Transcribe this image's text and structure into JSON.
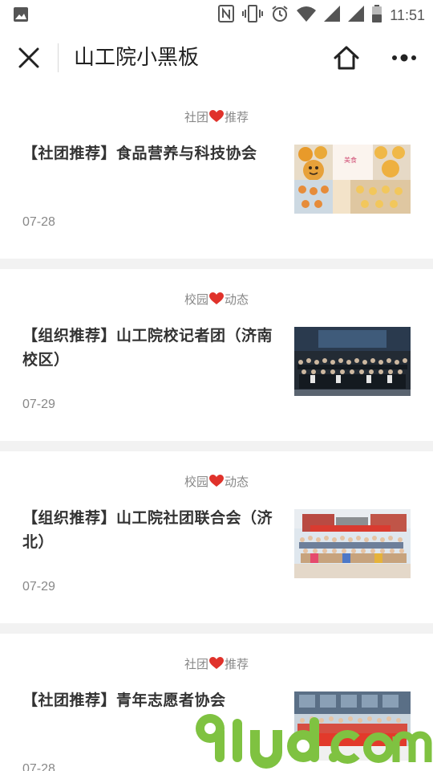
{
  "status_bar": {
    "time": "11:51",
    "icons": [
      "gallery-icon",
      "nfc-icon",
      "vibrate-icon",
      "alarm-icon",
      "wifi-icon",
      "signal-icon",
      "signal-icon",
      "battery-icon"
    ]
  },
  "title_bar": {
    "title": "山工院小黑板",
    "close_icon": "close-icon",
    "home_icon": "home-icon",
    "more_icon": "more-icon"
  },
  "articles": [
    {
      "category_left": "社团",
      "category_right": "推荐",
      "title": "【社团推荐】食品营养与科技协会",
      "date": "07-28",
      "thumb": "food-collage"
    },
    {
      "category_left": "校园",
      "category_right": "动态",
      "title": "【组织推荐】山工院校记者团（济南校区）",
      "date": "07-29",
      "thumb": "auditorium-group-photo"
    },
    {
      "category_left": "校园",
      "category_right": "动态",
      "title": "【组织推荐】山工院社团联合会（济北）",
      "date": "07-29",
      "thumb": "outdoor-group-photo"
    },
    {
      "category_left": "社团",
      "category_right": "推荐",
      "title": "【社团推荐】青年志愿者协会",
      "date": "07-28",
      "thumb": "volunteer-group-photo"
    }
  ],
  "colors": {
    "heart": "#e0322b",
    "watermark_green": "#7fc241",
    "divider_gap": "#f2f2f2"
  },
  "watermark": {
    "text": "91ud.com"
  }
}
